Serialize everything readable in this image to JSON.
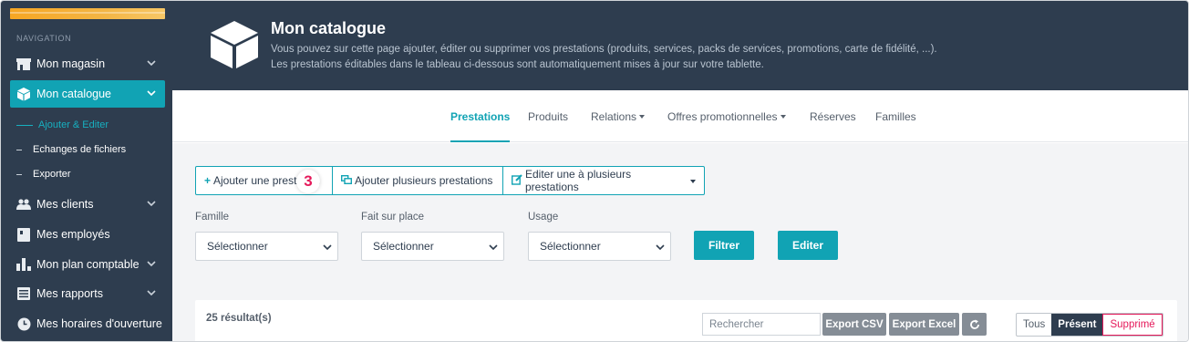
{
  "sidebar": {
    "heading": "NAVIGATION",
    "items": [
      {
        "label": "Mon magasin",
        "icon": "shop-icon",
        "has_chevron": true
      },
      {
        "label": "Mon catalogue",
        "icon": "box-icon",
        "has_chevron": true,
        "active": true
      },
      {
        "label": "Mes clients",
        "icon": "users-icon",
        "has_chevron": true
      },
      {
        "label": "Mes employés",
        "icon": "id-card-icon",
        "has_chevron": false
      },
      {
        "label": "Mon plan comptable",
        "icon": "bar-chart-icon",
        "has_chevron": true
      },
      {
        "label": "Mes rapports",
        "icon": "list-icon",
        "has_chevron": true
      },
      {
        "label": "Mes horaires d'ouverture",
        "icon": "clock-icon",
        "has_chevron": false
      }
    ],
    "subitems": [
      {
        "label": "Ajouter & Editer",
        "active": true
      },
      {
        "label": "Echanges de fichiers"
      },
      {
        "label": "Exporter"
      }
    ]
  },
  "header": {
    "title": "Mon catalogue",
    "description_line1": "Vous pouvez sur cette page ajouter, éditer ou supprimer vos prestations (produits, services, packs de services, promotions, carte de fidélité, ...).",
    "description_line2": "Les prestations éditables dans le tableau ci-dessous sont automatiquement mises à jour sur votre tablette."
  },
  "tabs": [
    {
      "label": "Prestations",
      "active": true
    },
    {
      "label": "Produits"
    },
    {
      "label": "Relations",
      "dropdown": true
    },
    {
      "label": "Offres promotionnelles",
      "dropdown": true
    },
    {
      "label": "Réserves"
    },
    {
      "label": "Familles"
    }
  ],
  "actions": {
    "add_one": "Ajouter une prestation",
    "add_many": "Ajouter plusieurs prestations",
    "edit_many": "Editer une à plusieurs prestations",
    "step_badge": "3"
  },
  "filters": {
    "famille_label": "Famille",
    "fait_label": "Fait sur place",
    "usage_label": "Usage",
    "select_value": "Sélectionner",
    "filter_button": "Filtrer",
    "edit_button": "Editer"
  },
  "results": {
    "count": "25 résultat(s)",
    "search_placeholder": "Rechercher",
    "export_csv": "Export CSV",
    "export_excel": "Export Excel",
    "seg_all": "Tous",
    "seg_present": "Présent",
    "seg_deleted": "Supprimé"
  },
  "colors": {
    "accent": "#11a3b4",
    "navy": "#2e3d4f",
    "danger": "#e5195a",
    "brand_bar": "#f6a623"
  }
}
